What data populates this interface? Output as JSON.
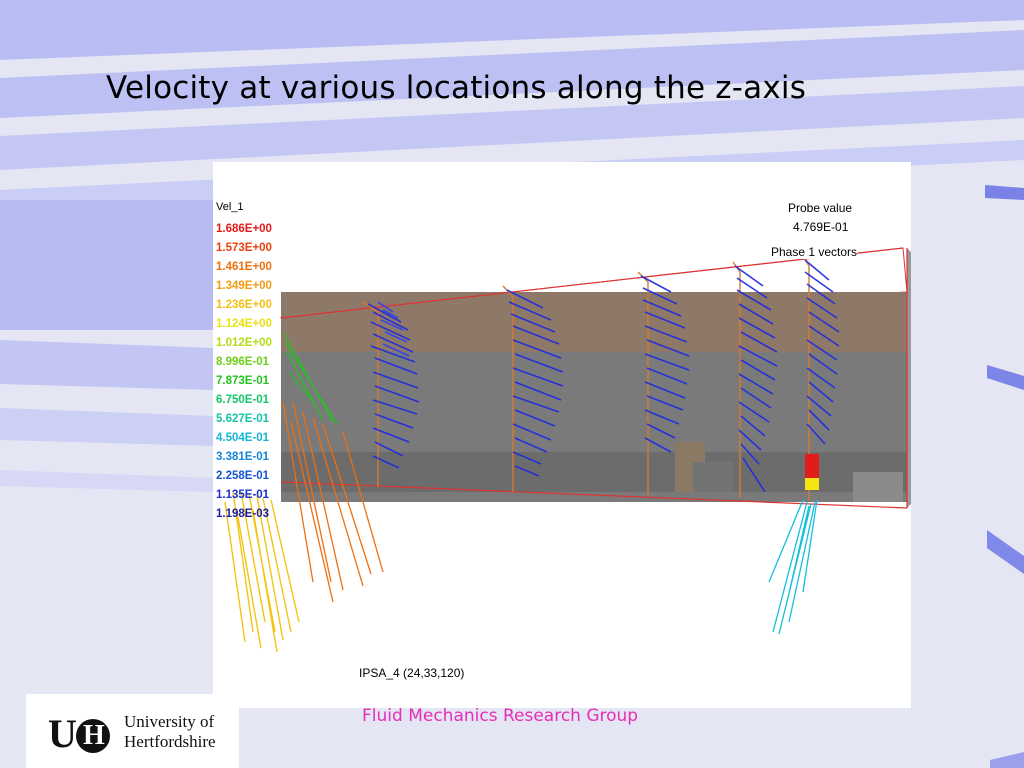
{
  "slide": {
    "title": "Velocity at various locations along the z-axis",
    "footer": "Fluid Mechanics Research Group",
    "accent_color": "#e62fb8",
    "background_stripes_color": "#b8bcf2"
  },
  "figure": {
    "legend_title": "Vel_1",
    "legend": [
      {
        "label": "1.686E+00",
        "color": "#e31b1b"
      },
      {
        "label": "1.573E+00",
        "color": "#e8410f"
      },
      {
        "label": "1.461E+00",
        "color": "#ee7010"
      },
      {
        "label": "1.349E+00",
        "color": "#f29a12"
      },
      {
        "label": "1.236E+00",
        "color": "#f3be12"
      },
      {
        "label": "1.124E+00",
        "color": "#e8e212"
      },
      {
        "label": "1.012E+00",
        "color": "#b5dc14"
      },
      {
        "label": "8.996E-01",
        "color": "#6ccf18"
      },
      {
        "label": "7.873E-01",
        "color": "#22c51e"
      },
      {
        "label": "6.750E-01",
        "color": "#16c46a"
      },
      {
        "label": "5.627E-01",
        "color": "#14c4a8"
      },
      {
        "label": "4.504E-01",
        "color": "#13b4d6"
      },
      {
        "label": "3.381E-01",
        "color": "#1486d8"
      },
      {
        "label": "2.258E-01",
        "color": "#1556d4"
      },
      {
        "label": "1.135E-01",
        "color": "#1a2fcc"
      },
      {
        "label": "1.198E-03",
        "color": "#1b1ea8"
      }
    ],
    "probe_label": "Probe value",
    "probe_value": "4.769E-01",
    "phase_label": "Phase 1 vectors",
    "grid_label": "IPSA_4 (24,33,120)"
  },
  "logo": {
    "mark_u": "U",
    "mark_h": "H",
    "line1": "University of",
    "line2": "Hertfordshire"
  }
}
